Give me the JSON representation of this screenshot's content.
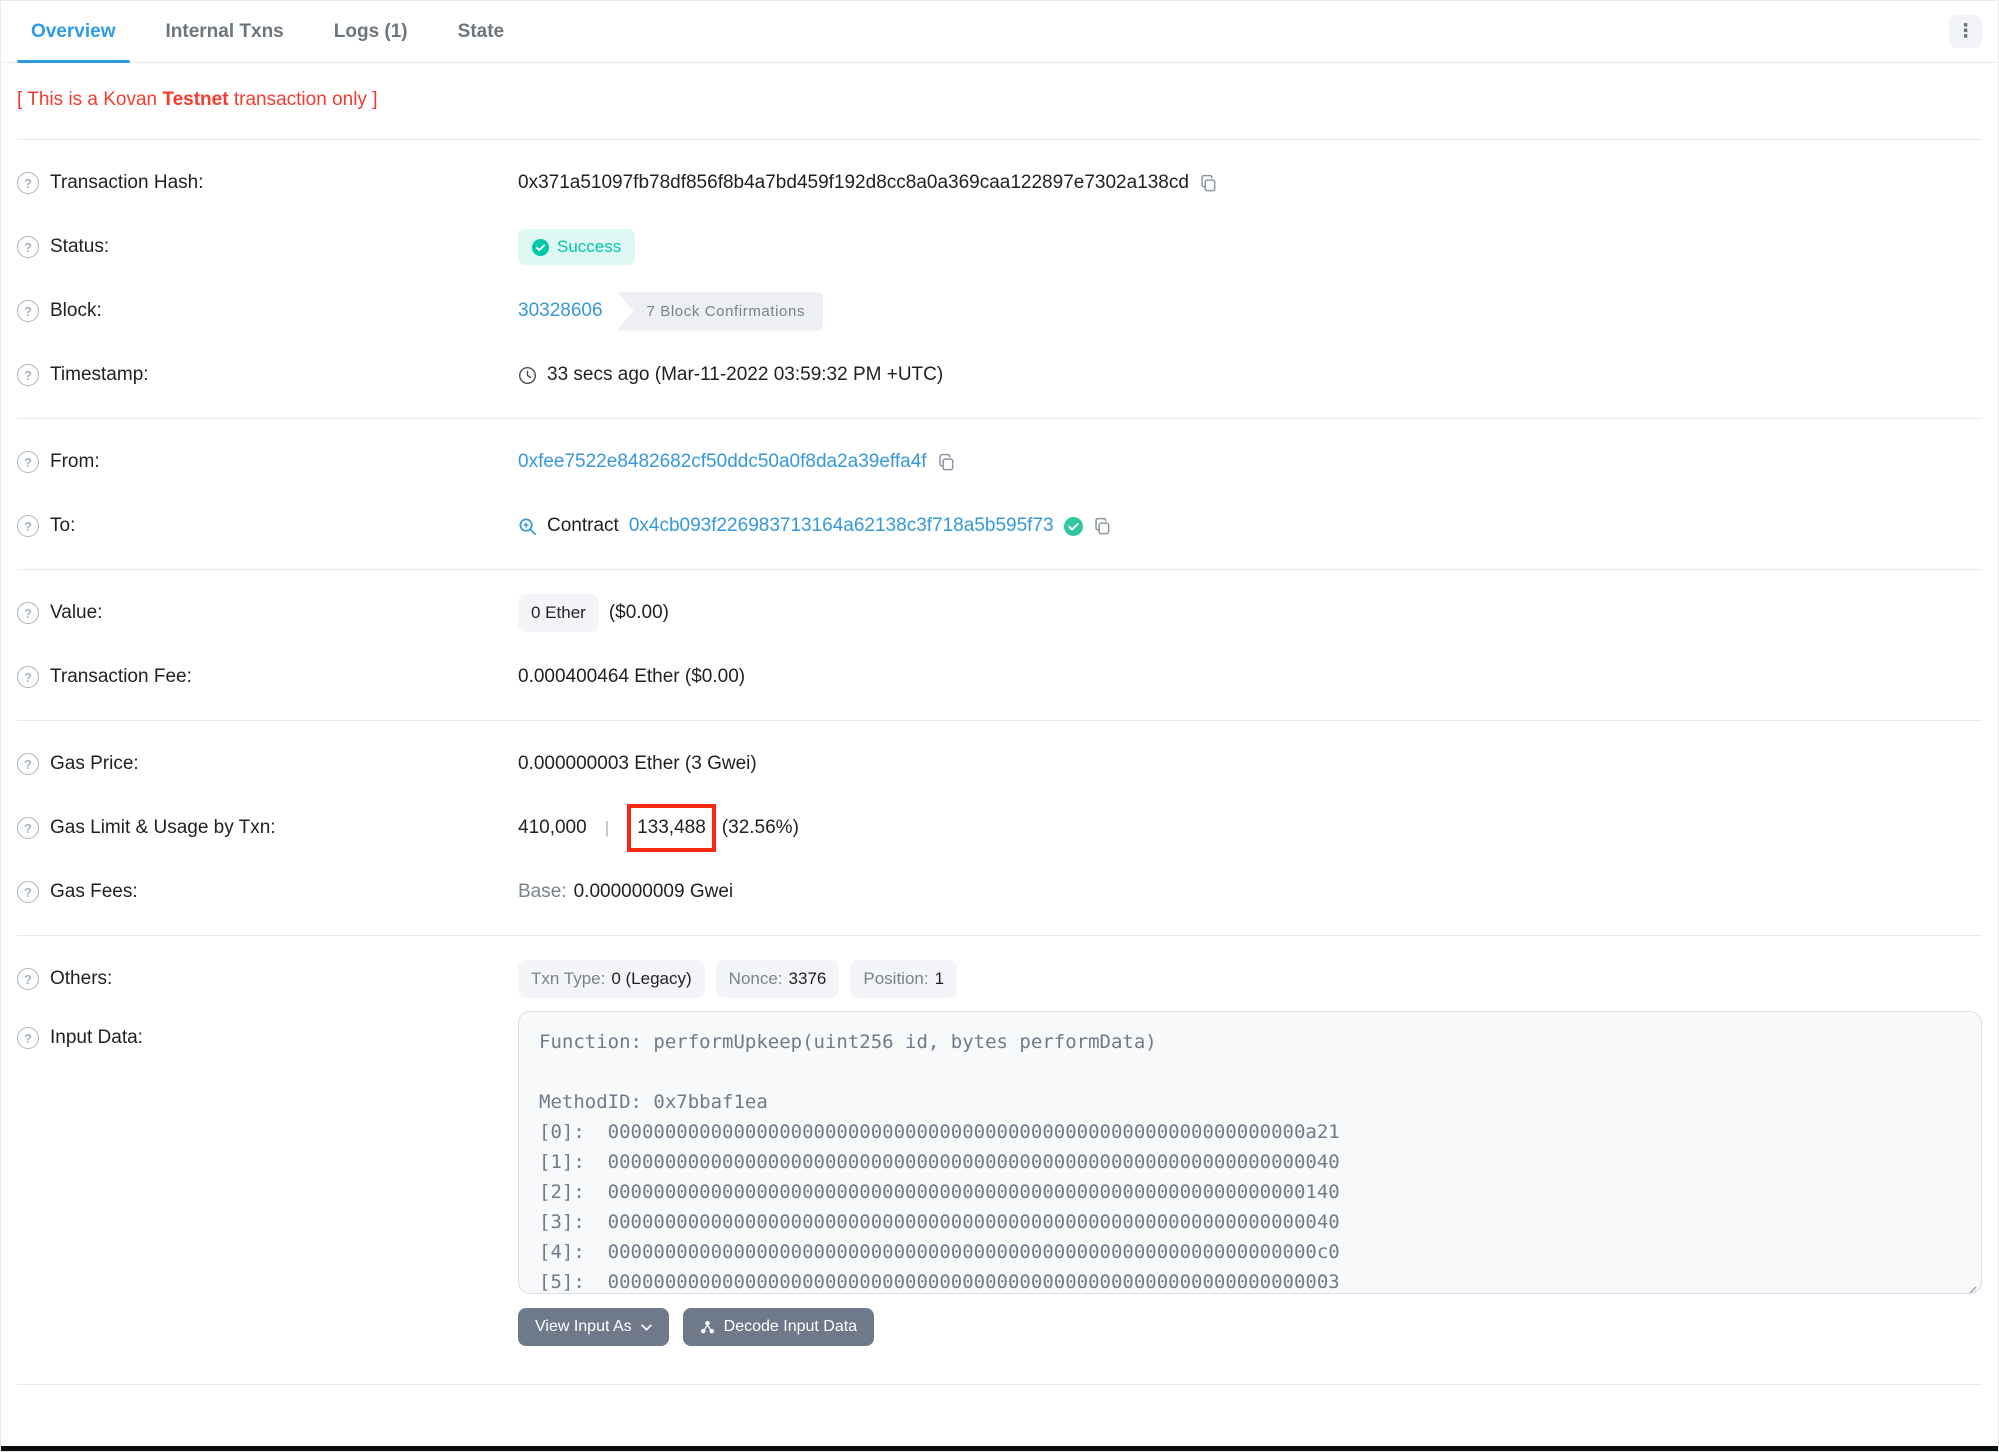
{
  "colors": {
    "accent_blue": "#3498db",
    "success_teal": "#00c9a7",
    "notice_red": "#f43b2d",
    "annotation_red": "#f5290f"
  },
  "tabs": [
    {
      "label": "Overview",
      "active": true
    },
    {
      "label": "Internal Txns",
      "active": false
    },
    {
      "label": "Logs (1)",
      "active": false
    },
    {
      "label": "State",
      "active": false
    }
  ],
  "kebab": "⋮",
  "notice": {
    "part1": "[ This is a Kovan ",
    "bold": "Testnet",
    "part2": " transaction only ]"
  },
  "rows": {
    "transaction_hash": {
      "label": "Transaction Hash:",
      "value": "0x371a51097fb78df856f8b4a7bd459f192d8cc8a0a369caa122897e7302a138cd"
    },
    "status": {
      "label": "Status:",
      "badge": "Success"
    },
    "block": {
      "label": "Block:",
      "number": "30328606",
      "confirmations": "7 Block Confirmations"
    },
    "timestamp": {
      "label": "Timestamp:",
      "value": "33 secs ago (Mar-11-2022 03:59:32 PM +UTC)"
    },
    "from": {
      "label": "From:",
      "address": "0xfee7522e8482682cf50ddc50a0f8da2a39effa4f"
    },
    "to": {
      "label": "To:",
      "prefix": "Contract",
      "address": "0x4cb093f226983713164a62138c3f718a5b595f73"
    },
    "value": {
      "label": "Value:",
      "badge": "0 Ether",
      "usd": "($0.00)"
    },
    "fee": {
      "label": "Transaction Fee:",
      "value": "0.000400464 Ether ($0.00)"
    },
    "gas_price": {
      "label": "Gas Price:",
      "value": "0.000000003 Ether (3 Gwei)"
    },
    "gas_limit": {
      "label": "Gas Limit & Usage by Txn:",
      "limit": "410,000",
      "separator": "|",
      "used": "133,488",
      "percent": "(32.56%)"
    },
    "gas_fees": {
      "label": "Gas Fees:",
      "base_label": "Base:",
      "base_value": "0.000000009 Gwei"
    },
    "others": {
      "label": "Others:",
      "pills": [
        {
          "key": "Txn Type:",
          "value": "0 (Legacy)"
        },
        {
          "key": "Nonce:",
          "value": "3376"
        },
        {
          "key": "Position:",
          "value": "1"
        }
      ]
    },
    "input_data": {
      "label": "Input Data:",
      "lines": [
        "Function: performUpkeep(uint256 id, bytes performData)",
        "",
        "MethodID: 0x7bbaf1ea",
        "[0]:  0000000000000000000000000000000000000000000000000000000000000a21",
        "[1]:  0000000000000000000000000000000000000000000000000000000000000040",
        "[2]:  0000000000000000000000000000000000000000000000000000000000000140",
        "[3]:  0000000000000000000000000000000000000000000000000000000000000040",
        "[4]:  00000000000000000000000000000000000000000000000000000000000000c0",
        "[5]:  0000000000000000000000000000000000000000000000000000000000000003"
      ]
    }
  },
  "buttons": {
    "view_input_as": "View Input As",
    "decode": "Decode Input Data"
  }
}
